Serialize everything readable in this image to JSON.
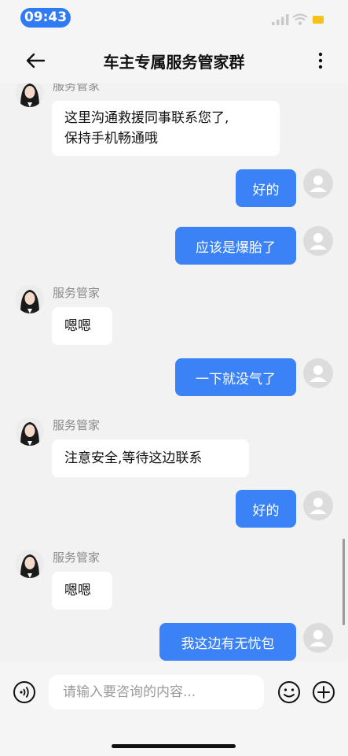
{
  "status_bar": {
    "time": "09:43"
  },
  "header": {
    "title": "车主专属服务管家群"
  },
  "messages": [
    {
      "sender": "服务管家",
      "text_line1": "这里沟通救援同事联系您了,",
      "text_line2": "保持手机畅通哦"
    },
    {
      "text": "好的"
    },
    {
      "text": "应该是爆胎了"
    },
    {
      "sender": "服务管家",
      "text": "嗯嗯"
    },
    {
      "text": "一下就没气了"
    },
    {
      "sender": "服务管家",
      "text": "注意安全,等待这边联系"
    },
    {
      "text": "好的"
    },
    {
      "sender": "服务管家",
      "text": "嗯嗯"
    },
    {
      "text": "我这边有无忧包"
    }
  ],
  "input": {
    "placeholder": "请输入要咨询的内容..."
  },
  "colors": {
    "accent": "#3b82f6",
    "time_pill": "#2f7bf6",
    "battery": "#f6c21a"
  },
  "icons": [
    "back-arrow-icon",
    "more-icon",
    "voice-icon",
    "emoji-icon",
    "add-icon",
    "person-icon"
  ]
}
